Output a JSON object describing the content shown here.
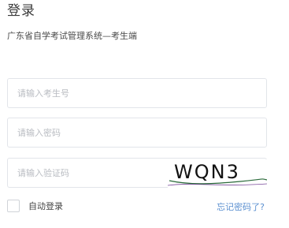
{
  "header": {
    "title": "登录",
    "subtitle": "广东省自学考试管理系统—考生端"
  },
  "form": {
    "username_placeholder": "请输入考生号",
    "password_placeholder": "请输入密码",
    "captcha_placeholder": "请输入验证码",
    "captcha_code": "WQN3"
  },
  "footer": {
    "remember_label": "自动登录",
    "forgot_link": "忘记密码了?"
  },
  "colors": {
    "link": "#5a8fd0",
    "border": "#e2e5ea",
    "placeholder": "#b9bcc2"
  }
}
